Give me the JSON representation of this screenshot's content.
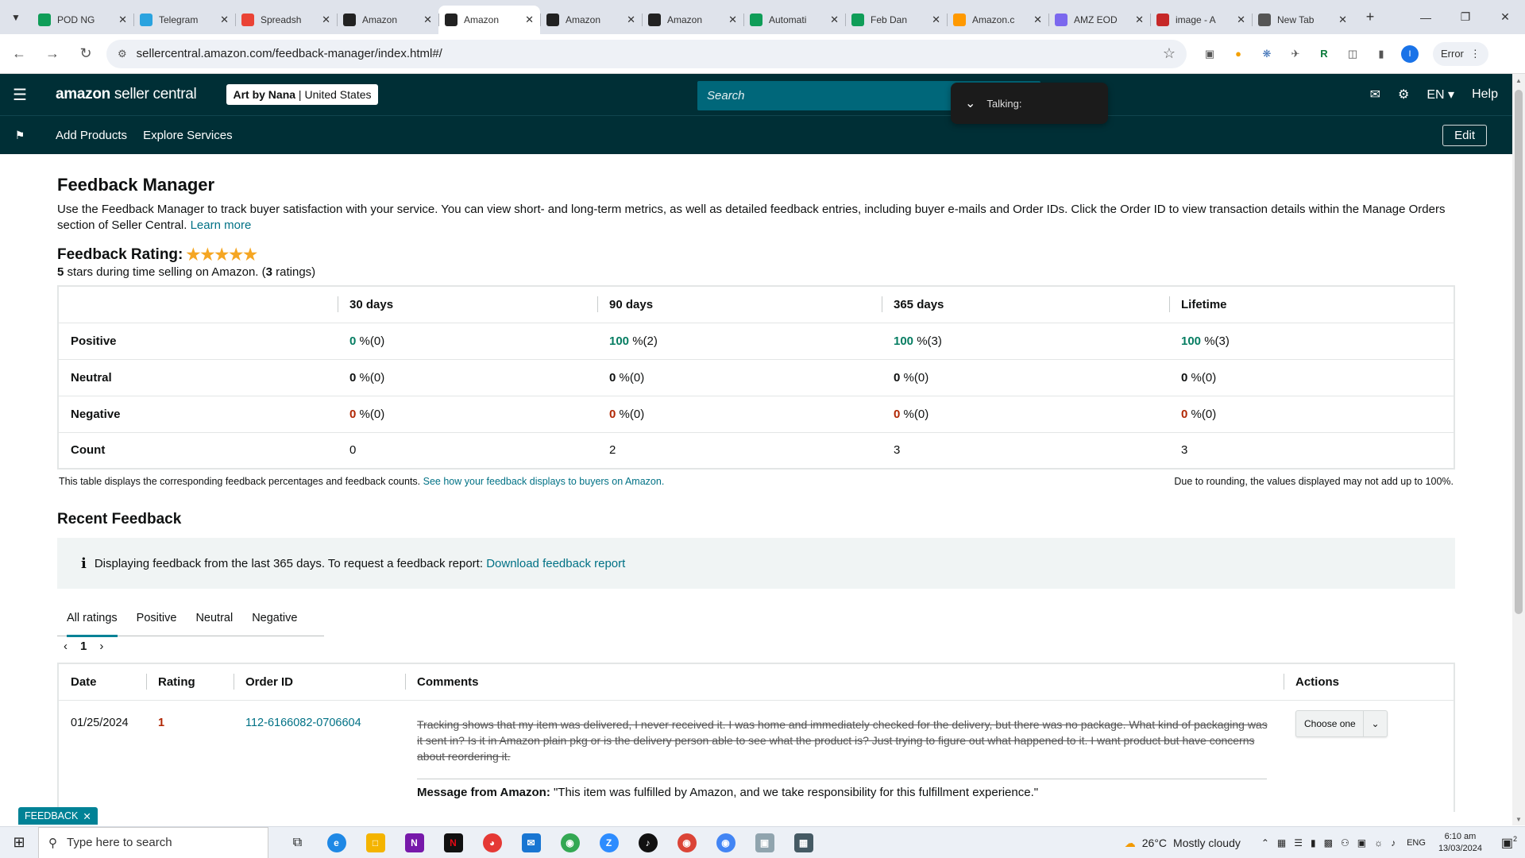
{
  "browser": {
    "tabs": [
      {
        "title": "POD NG",
        "icon": "sheets-icon",
        "color": "#0f9d58"
      },
      {
        "title": "Telegram",
        "icon": "telegram-icon",
        "color": "#2aa3df"
      },
      {
        "title": "Spreadsh",
        "icon": "gmail-icon",
        "color": "#ea4335"
      },
      {
        "title": "Amazon",
        "icon": "amazon-icon",
        "color": "#222222"
      },
      {
        "title": "Amazon",
        "icon": "amazon-icon",
        "color": "#222222",
        "active": true
      },
      {
        "title": "Amazon",
        "icon": "amazon-icon",
        "color": "#222222"
      },
      {
        "title": "Amazon",
        "icon": "amazon-icon",
        "color": "#222222"
      },
      {
        "title": "Automati",
        "icon": "sheets-icon",
        "color": "#0f9d58"
      },
      {
        "title": "Feb Dan",
        "icon": "sheets-icon",
        "color": "#0f9d58"
      },
      {
        "title": "Amazon.c",
        "icon": "amazon-a-icon",
        "color": "#ff9900"
      },
      {
        "title": "AMZ EOD",
        "icon": "clickup-icon",
        "color": "#7b68ee"
      },
      {
        "title": "image - A",
        "icon": "vector-icon",
        "color": "#c62828"
      },
      {
        "title": "New Tab",
        "icon": "chrome-icon",
        "color": "#555555"
      }
    ],
    "url": "sellercentral.amazon.com/feedback-manager/index.html#/",
    "profile_initial": "I",
    "error_label": "Error"
  },
  "header": {
    "logo_bold": "amazon",
    "logo_rest": " seller central",
    "store_name": "Art by Nana",
    "store_sep": " | ",
    "store_region": "United States",
    "search_placeholder": "Search",
    "talking_label": "Talking:",
    "lang": "EN",
    "help": "Help"
  },
  "subnav": {
    "links": [
      "Add Products",
      "Explore Services"
    ],
    "edit": "Edit"
  },
  "page": {
    "title": "Feedback Manager",
    "intro": "Use the Feedback Manager to track buyer satisfaction with your service. You can view short- and long-term metrics, as well as detailed feedback entries, including buyer e-mails and Order IDs. Click the Order ID to view transaction details within the Manage Orders section of Seller Central.",
    "learn_more": "Learn more",
    "rating_title": "Feedback Rating:",
    "rating_stars": 5,
    "rating_value": "5",
    "rating_text_a": " stars during time selling on Amazon. (",
    "rating_count": "3",
    "rating_text_b": " ratings)"
  },
  "metrics": {
    "columns": [
      "30 days",
      "90 days",
      "365 days",
      "Lifetime"
    ],
    "rows": [
      {
        "label": "Positive",
        "cells": [
          [
            "0",
            "%(0)"
          ],
          [
            "100",
            "%(2)"
          ],
          [
            "100",
            "%(3)"
          ],
          [
            "100",
            "%(3)"
          ]
        ],
        "color": "green"
      },
      {
        "label": "Neutral",
        "cells": [
          [
            "0",
            "%(0)"
          ],
          [
            "0",
            "%(0)"
          ],
          [
            "0",
            "%(0)"
          ],
          [
            "0",
            "%(0)"
          ]
        ],
        "color": "neutral"
      },
      {
        "label": "Negative",
        "cells": [
          [
            "0",
            "%(0)"
          ],
          [
            "0",
            "%(0)"
          ],
          [
            "0",
            "%(0)"
          ],
          [
            "0",
            "%(0)"
          ]
        ],
        "color": "red"
      }
    ],
    "count_label": "Count",
    "counts": [
      "0",
      "2",
      "3",
      "3"
    ],
    "note_left": "This table displays the corresponding feedback percentages and feedback counts.",
    "note_link": "See how your feedback displays to buyers on Amazon.",
    "note_right": "Due to rounding, the values displayed may not add up to 100%."
  },
  "recent": {
    "title": "Recent Feedback",
    "info_text": "Displaying feedback from the last 365 days. To request a feedback report:",
    "info_link": "Download feedback report",
    "tabs": [
      "All ratings",
      "Positive",
      "Neutral",
      "Negative"
    ],
    "page": "1",
    "columns": [
      "Date",
      "Rating",
      "Order ID",
      "Comments",
      "Actions"
    ],
    "rows": [
      {
        "date": "01/25/2024",
        "rating": "1",
        "order_id": "112-6166082-0706604",
        "comment": "Tracking shows that my item was delivered, I never received it. I was home and immediately checked for the delivery, but there was no package. What kind of packaging was it sent in? Is it in Amazon plain pkg or is the delivery person able to see what the product is? Just trying to figure out what happened to it. I want product but have concerns about reordering it.",
        "amazon_msg_label": "Message from Amazon:",
        "amazon_msg": " \"This item was fulfilled by Amazon, and we take responsibility for this fulfillment experience.\"",
        "action": "Choose one"
      }
    ]
  },
  "feedback_tab": "FEEDBACK",
  "taskbar": {
    "search_placeholder": "Type here to search",
    "weather_temp": "26°C",
    "weather_text": "Mostly cloudy",
    "lang": "ENG",
    "time": "6:10 am",
    "date": "13/03/2024",
    "notif_count": "2"
  }
}
